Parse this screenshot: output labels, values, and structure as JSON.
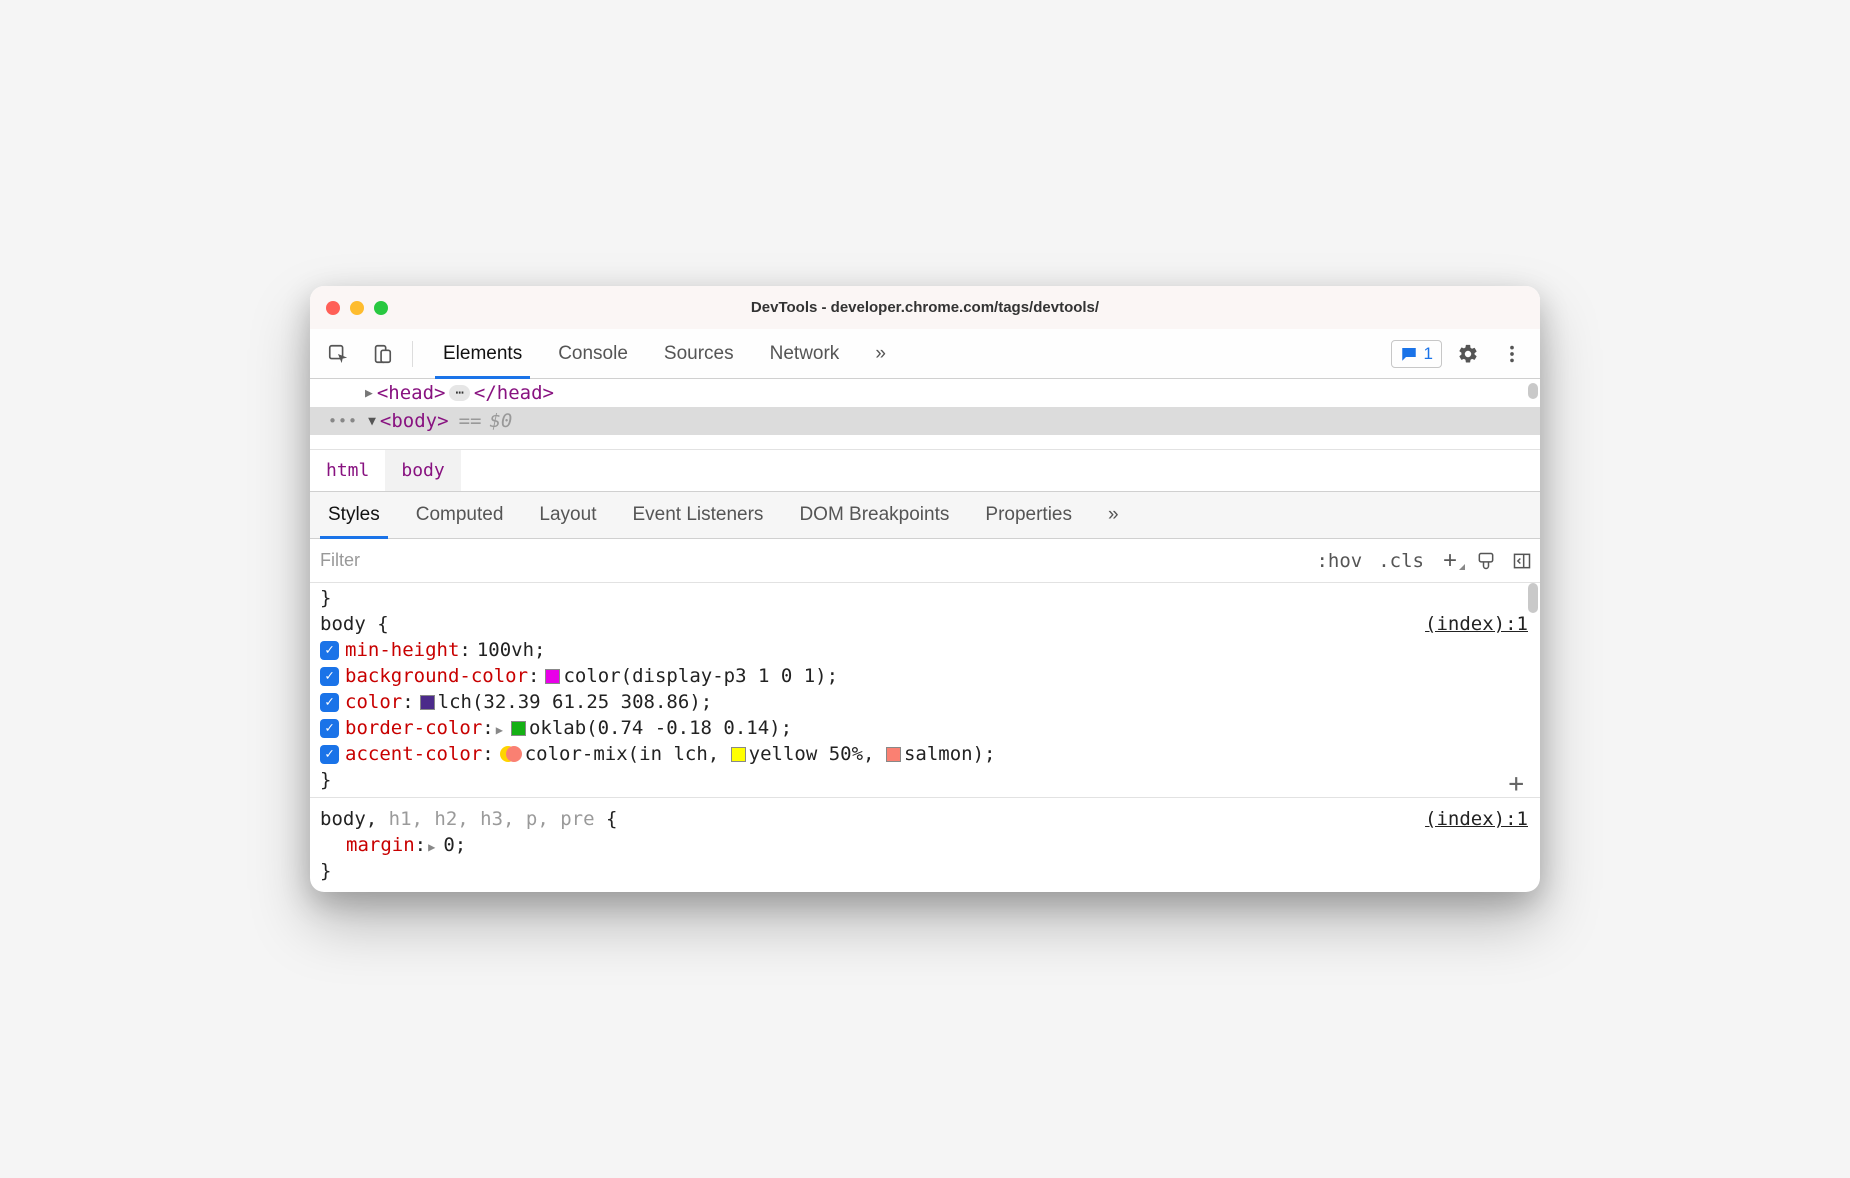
{
  "window": {
    "title": "DevTools - developer.chrome.com/tags/devtools/"
  },
  "main_tabs": {
    "items": [
      "Elements",
      "Console",
      "Sources",
      "Network"
    ],
    "overflow": "»",
    "issues_count": "1"
  },
  "elements_tree": {
    "head_open": "<head>",
    "head_ellipsis": "⋯",
    "head_close": "</head>",
    "body_open": "<body>",
    "eq": "==",
    "dollar": "$0",
    "row_dots": "•••"
  },
  "crumbs": {
    "items": [
      "html",
      "body"
    ]
  },
  "sub_tabs": {
    "items": [
      "Styles",
      "Computed",
      "Layout",
      "Event Listeners",
      "DOM Breakpoints",
      "Properties"
    ],
    "overflow": "»"
  },
  "filter": {
    "placeholder": "Filter",
    "hov": ":hov",
    "cls": ".cls"
  },
  "rules": [
    {
      "selector": "body",
      "source": "(index):1",
      "show_plus_hint": true,
      "props": [
        {
          "checked": true,
          "name": "min-height",
          "value_plain": "100vh"
        },
        {
          "checked": true,
          "name": "background-color",
          "swatch": "#e800e8",
          "value_plain": "color(display-p3 1 0 1)"
        },
        {
          "checked": true,
          "name": "color",
          "swatch": "#4b2a8a",
          "value_plain": "lch(32.39 61.25 308.86)"
        },
        {
          "checked": true,
          "name": "border-color",
          "expandable": true,
          "swatch": "#15b015",
          "value_plain": "oklab(0.74 -0.18 0.14)"
        },
        {
          "checked": true,
          "name": "accent-color",
          "mix_swatch": true,
          "mix_prefix": "color-mix(in lch,",
          "mix_a_swatch": "#ffff00",
          "mix_a_text": "yellow 50%,",
          "mix_b_swatch": "#fa8072",
          "mix_b_text": "salmon)"
        }
      ]
    },
    {
      "selector_head": "body,",
      "selector_dim": " h1, h2, h3, p, pre",
      "source": "(index):1",
      "props": [
        {
          "name": "margin",
          "expandable": true,
          "value_plain": "0"
        }
      ],
      "open": true
    }
  ]
}
